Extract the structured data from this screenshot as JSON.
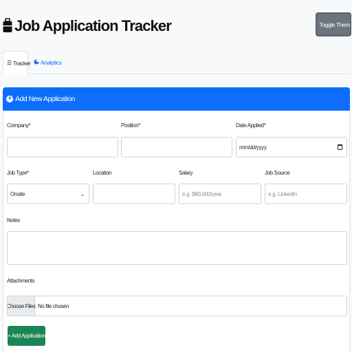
{
  "app": {
    "title": "Job Application Tracker",
    "theme_button": "Toggle Theme"
  },
  "tabs": [
    {
      "label": "Tracker",
      "icon": "list-icon",
      "active": true
    },
    {
      "label": "Analytics",
      "icon": "pie-chart-icon",
      "active": false
    }
  ],
  "form": {
    "header": "Add New Application",
    "company": {
      "label": "Company*",
      "value": ""
    },
    "position": {
      "label": "Position*",
      "value": ""
    },
    "date_applied": {
      "label": "Date Applied*",
      "value": "mm/dd/yyyy"
    },
    "job_type": {
      "label": "Job Type*",
      "value": "Onsite"
    },
    "location": {
      "label": "Location",
      "value": ""
    },
    "salary": {
      "label": "Salary",
      "placeholder": "e.g. $80,000/year"
    },
    "job_source": {
      "label": "Job Source",
      "placeholder": "e.g. LinkedIn"
    },
    "notes": {
      "label": "Notes",
      "value": ""
    },
    "attachments": {
      "label": "Attachments",
      "button": "Choose Files",
      "status": "No file chosen"
    },
    "submit": "+ Add Application"
  },
  "colors": {
    "primary": "#0d6efd",
    "success": "#198754",
    "secondary": "#6c757d",
    "background": "#f8f9fa"
  }
}
